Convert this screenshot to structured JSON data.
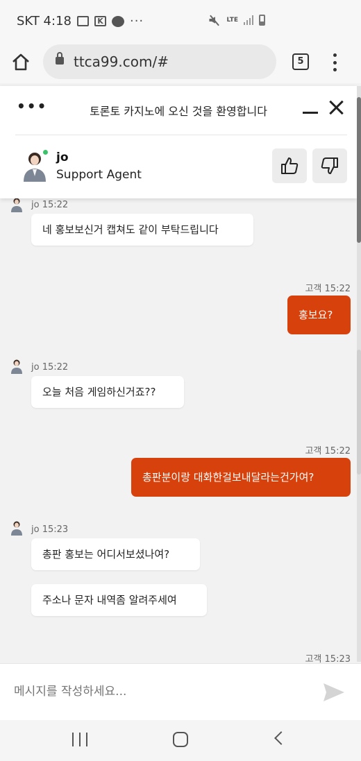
{
  "status_bar": {
    "carrier_time": "SKT 4:18",
    "network": "LTE"
  },
  "browser": {
    "url": "ttca99.com/#",
    "tab_count": "5"
  },
  "chat_header": {
    "title": "토론토 카지노에 오신 것을 환영합니다",
    "agent_name": "jo",
    "agent_role": "Support Agent",
    "online_color": "#3cc26a"
  },
  "messages": {
    "m1": {
      "meta": "jo 15:22",
      "bubbles": [
        "네 홍보보신거 캡쳐도 같이 부탁드립니다"
      ]
    },
    "m2": {
      "meta": "고객 15:22",
      "bubbles": [
        "홍보요?"
      ]
    },
    "m3": {
      "meta": "jo 15:22",
      "bubbles": [
        "오늘 처음 게임하신거죠??"
      ]
    },
    "m4": {
      "meta": "고객 15:22",
      "bubbles": [
        "총판분이랑 대화한걸보내달라는건가여?"
      ]
    },
    "m5": {
      "meta": "jo 15:23",
      "bubbles": [
        "총판 홍보는 어디서보셨나여?",
        "주소나 문자 내역좀 알려주세여"
      ]
    },
    "m6": {
      "meta": "고객 15:23"
    }
  },
  "compose": {
    "placeholder": "메시지를 작성하세요..."
  },
  "colors": {
    "customer_bubble": "#d7410c",
    "agent_bubble": "#ffffff",
    "chat_background": "#f2f2f2"
  }
}
